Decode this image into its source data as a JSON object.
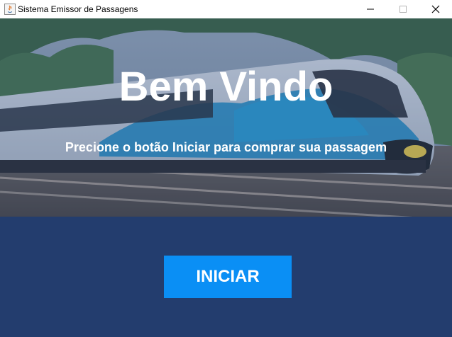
{
  "window": {
    "title": "Sistema Emissor de Passagens",
    "controls": [
      "minimize",
      "maximize",
      "close"
    ]
  },
  "hero": {
    "heading": "Bem Vindo",
    "subtitle": "Precione o botão Iniciar para comprar sua passagem",
    "background_image": "train-photo"
  },
  "actions": {
    "start_label": "INICIAR"
  },
  "colors": {
    "panel_background": "#233d6e",
    "button_background": "#0a8ff5",
    "text": "#ffffff"
  }
}
